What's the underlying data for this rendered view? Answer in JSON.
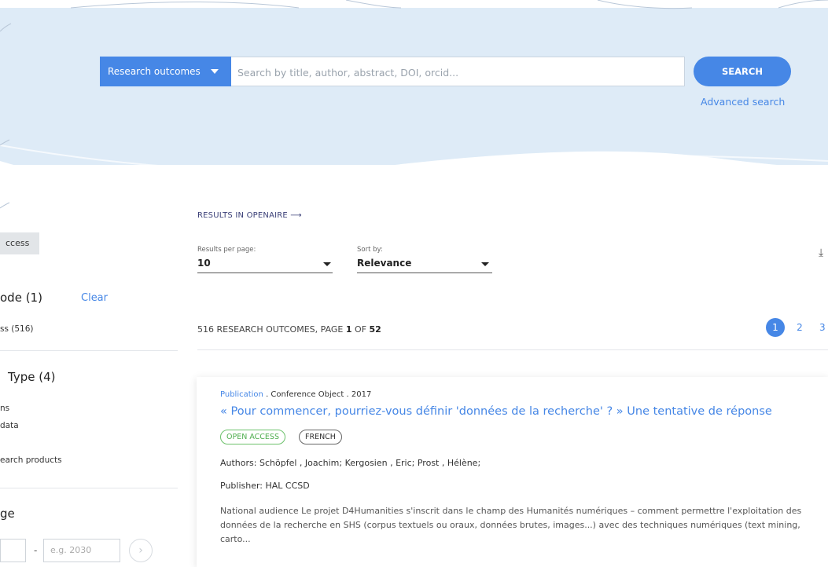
{
  "search": {
    "type_label": "Research outcomes",
    "placeholder": "Search by title, author, abstract, DOI, orcid...",
    "button_label": "SEARCH",
    "advanced_label": "Advanced search"
  },
  "filters": {
    "active_chip": "ccess",
    "access_mode": {
      "title": "ode (1)",
      "clear_label": "Clear",
      "items": [
        "ss (516)"
      ]
    },
    "type": {
      "title": "Type (4)",
      "items": [
        "ns",
        "data",
        "earch products"
      ]
    },
    "range": {
      "title": "ge",
      "from_placeholder": "",
      "to_placeholder": "e.g. 2030"
    }
  },
  "results": {
    "openaire_link": "RESULTS IN OPENAIRE ⟶",
    "per_page_label": "Results per page:",
    "per_page_value": "10",
    "sort_label": "Sort by:",
    "sort_value": "Relevance",
    "count_total": "516",
    "count_text": "RESEARCH OUTCOMES, PAGE",
    "page_current": "1",
    "page_of_text": "OF",
    "page_total": "52",
    "pages": [
      "1",
      "2",
      "3"
    ]
  },
  "result_item": {
    "type": "Publication",
    "meta_rest": " . Conference Object . 2017",
    "title": "« Pour commencer, pourriez-vous définir 'données de la recherche' ? » Une tentative de réponse",
    "badges": [
      "OPEN ACCESS",
      "FRENCH"
    ],
    "authors_label": "Authors:",
    "authors": "Schöpfel , Joachim; Kergosien , Eric; Prost , Hélène;",
    "publisher_label": "Publisher:",
    "publisher": "HAL CCSD",
    "description": "National audience Le projet D4Humanities s'inscrit dans le champ des Humanités numériques – comment permettre l'exploitation des données de la recherche en SHS (corpus textuels ou oraux, données brutes, images...) avec des techniques numériques (text mining, carto..."
  },
  "icons": [
    "download-icon",
    "chevron-right-icon",
    "caret-down-icon"
  ],
  "colors": {
    "accent": "#4687e6",
    "hero_bg": "#deebf7",
    "open_access": "#4fae4e"
  }
}
